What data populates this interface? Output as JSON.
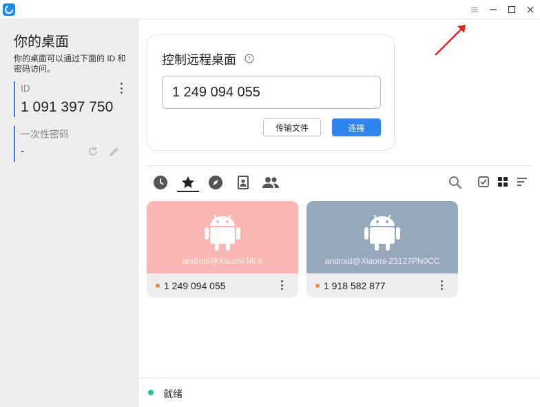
{
  "colors": {
    "accent": "#2f84f0",
    "online_dot": "#f08a3c",
    "ready_dot": "#2fbf8f",
    "peer1_bg": "#f9b6b2",
    "peer2_bg": "#97a8bd",
    "annotation_arrow": "#e8231d"
  },
  "titlebar": {
    "icons": [
      "app-logo-icon",
      "menu-icon",
      "minimize-icon",
      "maximize-icon",
      "close-icon"
    ]
  },
  "left": {
    "title": "你的桌面",
    "desc": "你的桌面可以通过下面的 ID 和密码访问。",
    "id_label": "ID",
    "id_value": "1 091 397 750",
    "pw_label": "一次性密码",
    "pw_value": "-"
  },
  "control": {
    "title": "控制远程桌面",
    "id_input": "1 249 094 055",
    "transfer_label": "传输文件",
    "connect_label": "连接"
  },
  "tabs": [
    "clock-icon",
    "star-icon",
    "compass-icon",
    "address-book-icon",
    "group-icon"
  ],
  "active_tab": "star-icon",
  "tools": [
    "search-icon",
    "checkbox-icon",
    "grid-icon",
    "sort-icon"
  ],
  "peers": [
    {
      "host": "android@Xiaomi-MI 8",
      "id": "1 249 094 055",
      "platform": "android-icon"
    },
    {
      "host": "android@Xiaomi-23127PN0CC",
      "id": "1 918 582 877",
      "platform": "android-icon"
    }
  ],
  "status": {
    "text": "就绪"
  }
}
